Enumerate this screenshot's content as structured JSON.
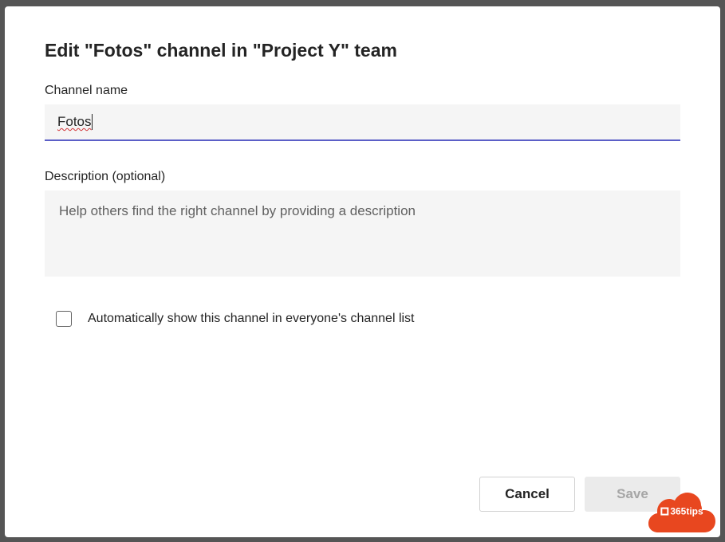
{
  "dialog": {
    "title": "Edit \"Fotos\" channel in \"Project Y\" team",
    "channelName": {
      "label": "Channel name",
      "value": "Fotos"
    },
    "description": {
      "label": "Description (optional)",
      "placeholder": "Help others find the right channel by providing a description",
      "value": ""
    },
    "autoShow": {
      "label": "Automatically show this channel in everyone's channel list",
      "checked": false
    },
    "buttons": {
      "cancel": "Cancel",
      "save": "Save"
    }
  },
  "watermark": {
    "text": "365tips"
  }
}
